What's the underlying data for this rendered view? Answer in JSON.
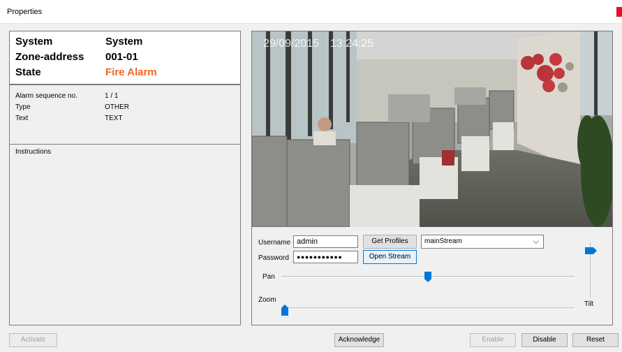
{
  "window": {
    "title": "Properties",
    "close_label": "x"
  },
  "summary": {
    "system_label": "System",
    "system_value": "System",
    "zone_label": "Zone-address",
    "zone_value": "001-01",
    "state_label": "State",
    "state_value": "Fire Alarm",
    "alarm_color": "#f26522"
  },
  "details": {
    "seq_label": "Alarm sequence no.",
    "seq_value": "1 / 1",
    "type_label": "Type",
    "type_value": "OTHER",
    "text_label": "Text",
    "text_value": "TEXT"
  },
  "instructions": {
    "label": "Instructions"
  },
  "video": {
    "date": "29/09/2015",
    "time": "13:24:25"
  },
  "camera": {
    "username_label": "Username",
    "username_value": "admin",
    "password_label": "Password",
    "password_value": "●●●●●●●●●●●",
    "get_profiles_label": "Get Profiles",
    "open_stream_label": "Open Stream",
    "profile_selected": "mainStream",
    "pan_label": "Pan",
    "zoom_label": "Zoom",
    "tilt_label": "Tilt",
    "pan_value_pct": 50,
    "zoom_value_pct": 0,
    "tilt_value_pct": 85
  },
  "footer": {
    "activate_label": "Activate",
    "acknowledge_label": "Acknowledge",
    "enable_label": "Enable",
    "disable_label": "Disable",
    "reset_label": "Reset"
  }
}
